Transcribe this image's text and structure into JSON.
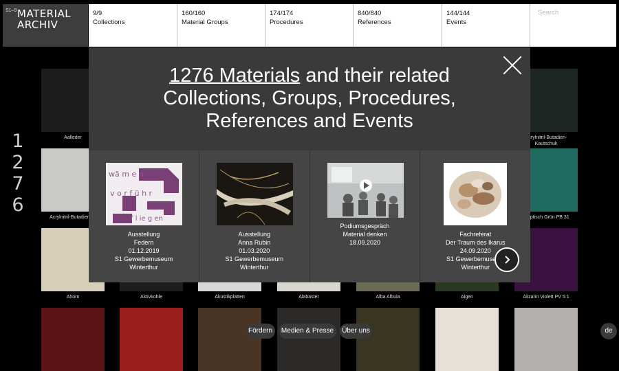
{
  "logo": {
    "superscript": "S1–9",
    "line1": "MATERIAL",
    "line2": "ARCHIV"
  },
  "nav": [
    {
      "count": "9/9",
      "label": "Collections"
    },
    {
      "count": "160/160",
      "label": "Material Groups"
    },
    {
      "count": "174/174",
      "label": "Procedures"
    },
    {
      "count": "840/840",
      "label": "References"
    },
    {
      "count": "144/144",
      "label": "Events"
    }
  ],
  "search": {
    "placeholder": "Search"
  },
  "material_count_digits": [
    "1",
    "2",
    "7",
    "6"
  ],
  "tiles": [
    {
      "label": "Aalleder",
      "color": "#1c1c1c"
    },
    {
      "label": "Acrylnitril-Butadien-Kautschuk",
      "color": "#1e2624"
    },
    {
      "label": "Acrylnitril-Butadien-…",
      "color": "#c9cac5"
    },
    {
      "label": "…yptisch Grün PB 31",
      "color": "#1f6b60"
    },
    {
      "label": "Ahorn",
      "color": "#d8cfb9"
    },
    {
      "label": "Aktivkohle",
      "color": "#1d1d1d"
    },
    {
      "label": "Akustikplatten",
      "color": "#d8d8d8"
    },
    {
      "label": "Alabaster",
      "color": "#d9d6cf"
    },
    {
      "label": "Alba Albula",
      "color": "#6b6a52"
    },
    {
      "label": "Algen",
      "color": "#2a3a22"
    },
    {
      "label": "Alizarin Violett PV 5:1",
      "color": "#3a1240"
    },
    {
      "label": "",
      "color": "#5a1414"
    },
    {
      "label": "",
      "color": "#9a1f1a"
    },
    {
      "label": "",
      "color": "#4a3424"
    },
    {
      "label": "",
      "color": "#2c2a28"
    },
    {
      "label": "",
      "color": "#3a3520"
    },
    {
      "label": "",
      "color": "#e5e1d6"
    },
    {
      "label": "",
      "color": "#b3b0ad"
    }
  ],
  "modal": {
    "headline_link": "1276 Materials",
    "headline_rest_1": " and their related",
    "headline_line2": "Collections, Groups, Procedures,",
    "headline_line3": "References and Events",
    "events": [
      {
        "type": "Ausstellung",
        "title": "Federn",
        "date": "01.12.2019",
        "venue": "S1 Gewerbemuseum",
        "city": "Winterthur"
      },
      {
        "type": "Ausstellung",
        "title": "Anna Rubin",
        "date": "01.03.2020",
        "venue": "S1 Gewerbemuseum",
        "city": "Winterthur"
      },
      {
        "type": "Podiumsgespräch",
        "title": "Material denken",
        "date": "18.09.2020"
      },
      {
        "type": "Fachreferat",
        "title": "Der Traum des Ikarus",
        "date": "24.09.2020",
        "venue": "S1 Gewerbemuseum",
        "city": "Winterthur"
      }
    ],
    "thumb1_text": [
      "wä m e n",
      "v o r f ü h r",
      "f l ie g en"
    ]
  },
  "footer": {
    "items": [
      "Fördern",
      "Medien & Presse",
      "Über uns"
    ],
    "language": "de"
  }
}
